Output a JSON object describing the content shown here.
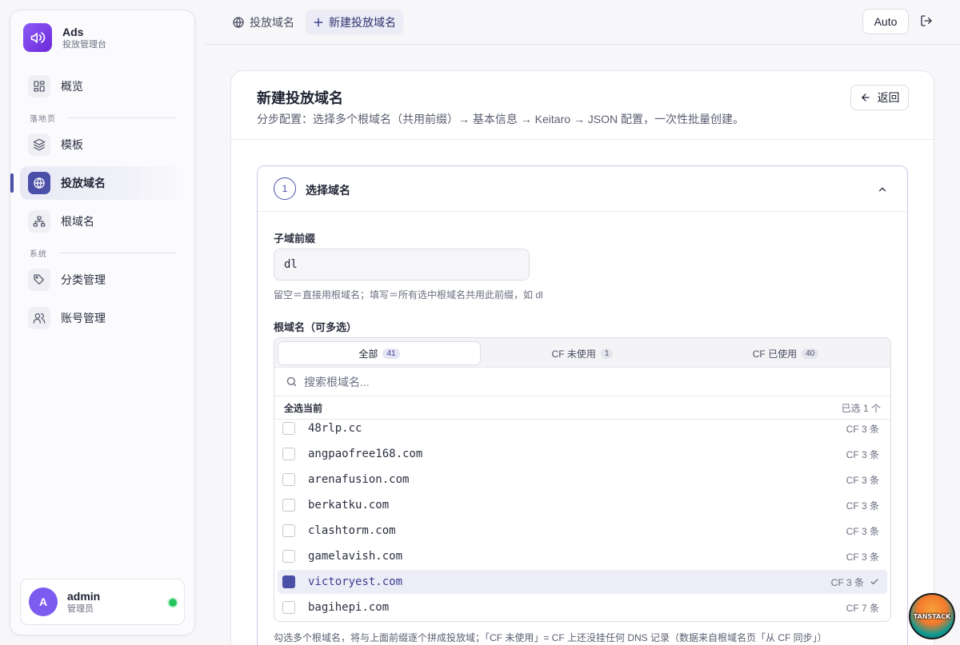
{
  "brand": {
    "title": "Ads",
    "subtitle": "投放管理台"
  },
  "sidebar": {
    "items": [
      {
        "label": "概览",
        "icon": "dashboard-icon"
      },
      {
        "section": "落地页"
      },
      {
        "label": "模板",
        "icon": "layers-icon"
      },
      {
        "label": "投放域名",
        "icon": "globe-icon",
        "active": true
      },
      {
        "label": "根域名",
        "icon": "sitemap-icon"
      },
      {
        "section": "系统"
      },
      {
        "label": "分类管理",
        "icon": "tag-icon"
      },
      {
        "label": "账号管理",
        "icon": "users-icon"
      }
    ],
    "user": {
      "initial": "A",
      "name": "admin",
      "role": "管理员",
      "status_color": "#22c55e"
    }
  },
  "header": {
    "breadcrumb": [
      {
        "label": "投放域名",
        "icon": "globe-icon"
      },
      {
        "label": "新建投放域名",
        "icon": "plus-icon"
      }
    ],
    "theme_button": "Auto"
  },
  "page": {
    "title": "新建投放域名",
    "description": "分步配置：选择多个根域名（共用前缀）→ 基本信息 → Keitaro → JSON 配置，一次性批量创建。",
    "back_label": "返回"
  },
  "step1": {
    "number": "1",
    "title": "选择域名",
    "prefix_label": "子域前缀",
    "prefix_value": "dl",
    "prefix_hint": "留空＝直接用根域名；填写＝所有选中根域名共用此前缀，如 dl",
    "root_label": "根域名（可多选）",
    "tabs": [
      {
        "label": "全部",
        "count": "41",
        "active": true
      },
      {
        "label": "CF 未使用",
        "count": "1"
      },
      {
        "label": "CF 已使用",
        "count": "40"
      }
    ],
    "search_placeholder": "搜索根域名...",
    "select_all_label": "全选当前",
    "selected_count": "已选 1 个",
    "domains": [
      {
        "name": "48rlp.cc",
        "cf": "CF 3 条",
        "checked": false
      },
      {
        "name": "angpaofree168.com",
        "cf": "CF 3 条",
        "checked": false
      },
      {
        "name": "arenafusion.com",
        "cf": "CF 3 条",
        "checked": false
      },
      {
        "name": "berkatku.com",
        "cf": "CF 3 条",
        "checked": false
      },
      {
        "name": "clashtorm.com",
        "cf": "CF 3 条",
        "checked": false
      },
      {
        "name": "gamelavish.com",
        "cf": "CF 3 条",
        "checked": false
      },
      {
        "name": "victoryest.com",
        "cf": "CF 3 条",
        "checked": true
      },
      {
        "name": "bagihepi.com",
        "cf": "CF 7 条",
        "checked": false
      }
    ],
    "footnote": "勾选多个根域名，将与上面前缀逐个拼成投放域；「CF 未使用」= CF 上还没挂任何 DNS 记录（数据来自根域名页「从 CF 同步」）"
  },
  "floating_badge": {
    "text": "TANSTACK"
  },
  "colors": {
    "accent": "#4b4fa8",
    "brand": "#7c3aed",
    "online": "#22c55e"
  }
}
